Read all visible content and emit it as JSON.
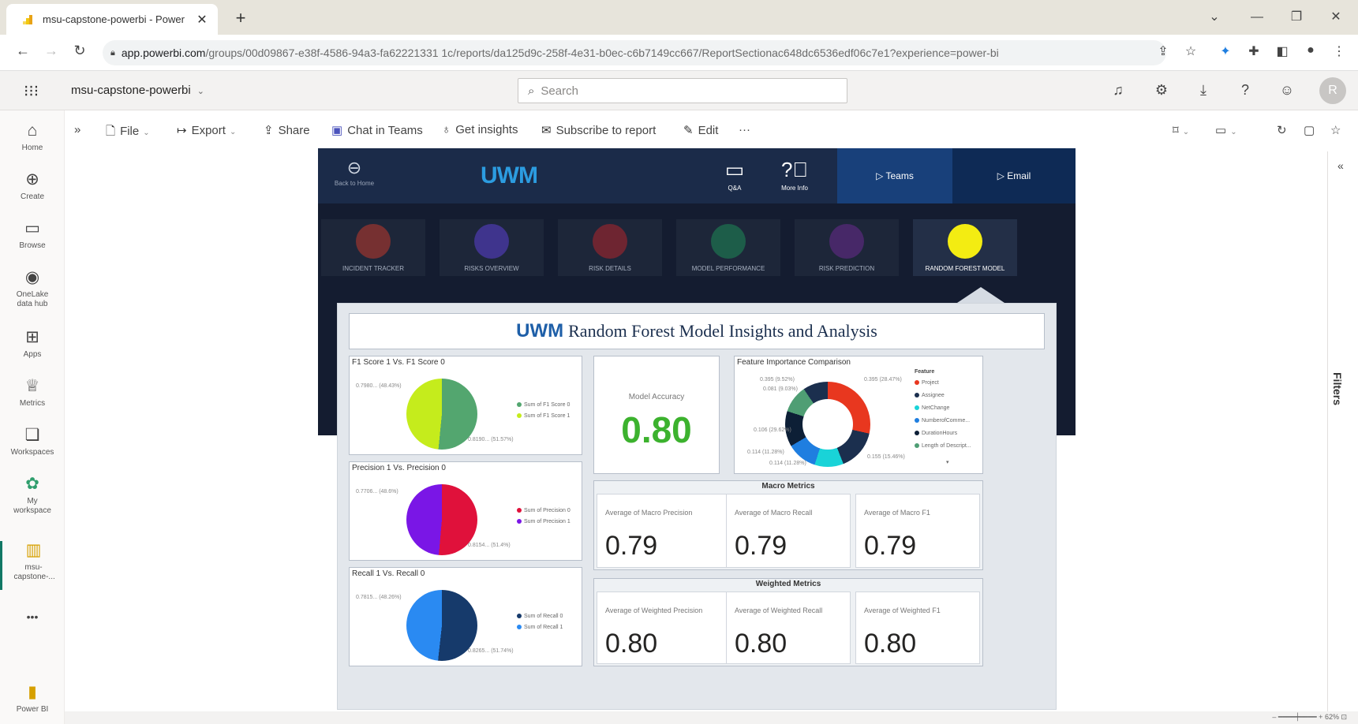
{
  "browser": {
    "tab_title": "msu-capstone-powerbi - Power",
    "url_host": "app.powerbi.com",
    "url_path": "/groups/00d09867-e38f-4586-94a3-fa62221331 1c/reports/da125d9c-258f-4e31-b0ec-c6b7149cc667/ReportSectionac648dc6536edf06c7e1?experience=power-bi"
  },
  "header": {
    "workspace": "msu-capstone-powerbi",
    "search_placeholder": "Search",
    "avatar_initial": "R"
  },
  "leftnav": [
    {
      "name": "home",
      "icon": "⌂",
      "label": "Home"
    },
    {
      "name": "create",
      "icon": "⊕",
      "label": "Create"
    },
    {
      "name": "browse",
      "icon": "▭",
      "label": "Browse"
    },
    {
      "name": "onelake",
      "icon": "◉",
      "label": "OneLake data hub"
    },
    {
      "name": "apps",
      "icon": "⊞",
      "label": "Apps"
    },
    {
      "name": "metrics",
      "icon": "♕",
      "label": "Metrics"
    },
    {
      "name": "workspaces",
      "icon": "❏",
      "label": "Workspaces"
    },
    {
      "name": "my-workspace",
      "icon": "✿",
      "label": "My workspace"
    },
    {
      "name": "msu-capstone",
      "icon": "▥",
      "label": "msu-capstone-..."
    },
    {
      "name": "more",
      "icon": "•••",
      "label": ""
    },
    {
      "name": "powerbi",
      "icon": "▮",
      "label": "Power BI"
    }
  ],
  "actions": {
    "file": "File",
    "export": "Export",
    "share": "Share",
    "chat": "Chat in Teams",
    "insights": "Get insights",
    "subscribe": "Subscribe to report",
    "edit": "Edit",
    "more": "···"
  },
  "filters_label": "Filters",
  "report": {
    "back_label": "Back to Home",
    "logo": "UWM",
    "qa_label": "Q&A",
    "moreinfo_label": "More Info",
    "teams_label": "▷  Teams",
    "email_label": "▷  Email",
    "tiles": [
      {
        "label": "INCIDENT TRACKER",
        "color": "#c0392b"
      },
      {
        "label": "RISKS OVERVIEW",
        "color": "#5b3fd4"
      },
      {
        "label": "RISK DETAILS",
        "color": "#b0252c"
      },
      {
        "label": "MODEL PERFORMANCE",
        "color": "#1d8b57"
      },
      {
        "label": "RISK PREDICTION",
        "color": "#6a2a8f"
      },
      {
        "label": "RANDOM FOREST MODEL",
        "color": "#f3ec12"
      }
    ],
    "title_logo": "UWM",
    "title": "Random Forest Model Insights and Analysis",
    "f1": {
      "title": "F1 Score 1 Vs. F1 Score 0",
      "lbl_a": "0.7980... (48.43%)",
      "lbl_b": "0.8190... (51.57%)",
      "legend": [
        "Sum of F1 Score 0",
        "Sum of F1 Score 1"
      ]
    },
    "precision": {
      "title": "Precision 1 Vs. Precision 0",
      "lbl_a": "0.7706... (48.6%)",
      "lbl_b": "0.8154... (51.4%)",
      "legend": [
        "Sum of Precision 0",
        "Sum of Precision 1"
      ]
    },
    "recall": {
      "title": "Recall 1 Vs. Recall 0",
      "lbl_a": "0.7815... (48.26%)",
      "lbl_b": "0.8265... (51.74%)",
      "legend": [
        "Sum of Recall 0",
        "Sum of Recall 1"
      ]
    },
    "accuracy": {
      "label": "Model Accuracy",
      "value": "0.80"
    },
    "feature": {
      "title": "Feature Importance Comparison",
      "legend_title": "Feature",
      "legend": [
        {
          "name": "Project",
          "color": "#e8371f"
        },
        {
          "name": "Assignee",
          "color": "#1b2f4e"
        },
        {
          "name": "NetChange",
          "color": "#19d3d8"
        },
        {
          "name": "NumberofComme...",
          "color": "#1f7ee0"
        },
        {
          "name": "DurationHours",
          "color": "#0d1f36"
        },
        {
          "name": "Length of Descript...",
          "color": "#4f9e74"
        }
      ],
      "labels": [
        "0.395 (9.52%)",
        "0.081 (9.03%)",
        "0.106 (29.62%)",
        "0.114 (11.28%)",
        "0.114 (11.28%)",
        "0.155 (15.46%)",
        "0.395 (28.47%)"
      ]
    },
    "macro": {
      "title": "Macro Metrics",
      "items": [
        {
          "label": "Average of Macro Precision",
          "value": "0.79"
        },
        {
          "label": "Average of Macro Recall",
          "value": "0.79"
        },
        {
          "label": "Average of Macro F1",
          "value": "0.79"
        }
      ]
    },
    "weighted": {
      "title": "Weighted Metrics",
      "items": [
        {
          "label": "Average of Weighted Precision",
          "value": "0.80"
        },
        {
          "label": "Average of Weighted Recall",
          "value": "0.80"
        },
        {
          "label": "Average of Weighted F1",
          "value": "0.80"
        }
      ]
    }
  },
  "zoom": "62%"
}
